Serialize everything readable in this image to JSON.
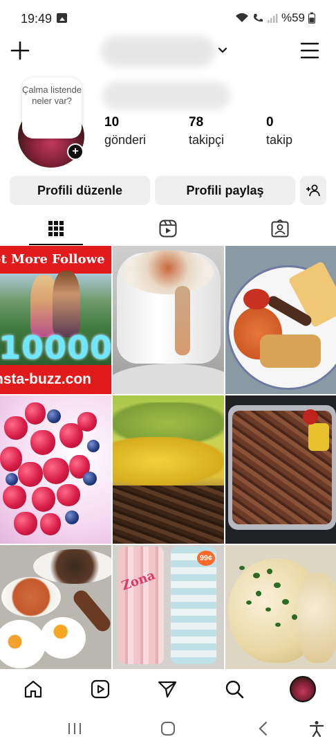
{
  "status_bar": {
    "time": "19:49",
    "battery": "%59"
  },
  "profile": {
    "note_text": "Çalma listende neler var?",
    "stats": {
      "posts_count": "10",
      "posts_label": "gönderi",
      "followers_count": "78",
      "followers_label": "takipçi",
      "following_count": "0",
      "following_label": "takip"
    }
  },
  "buttons": {
    "edit_profile": "Profili düzenle",
    "share_profile": "Profili paylaş"
  },
  "tabs": [
    "grid-icon",
    "reels-icon",
    "tagged-icon"
  ],
  "posts": {
    "ad_top_text": "et More Followe",
    "ad_number": "10000",
    "ad_bottom_text": "nsta-buzz.con",
    "can_label": "Zona",
    "can_price": "99¢"
  },
  "bottom_nav": [
    "home-icon",
    "reels-icon",
    "send-icon",
    "search-icon",
    "profile-avatar"
  ],
  "colors": {
    "button_bg": "#efefef",
    "ad_red": "#e11b1b",
    "ad_cyan": "#6ee7ff"
  }
}
